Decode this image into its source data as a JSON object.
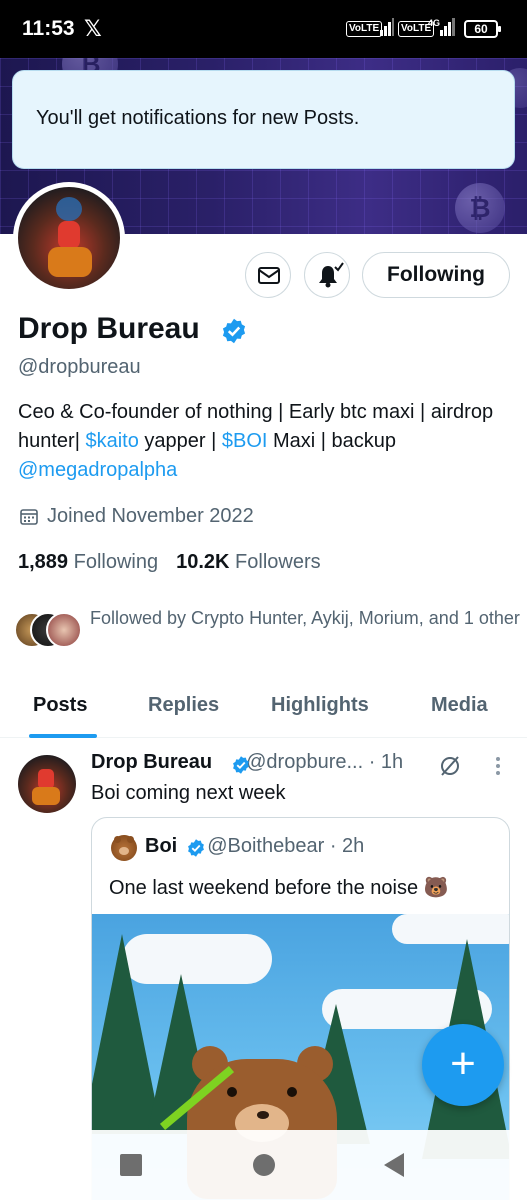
{
  "status_bar": {
    "time": "11:53",
    "app_icon": "x-logo",
    "volte1": "VoLTE",
    "volte2": "VoLTE",
    "network": "4G",
    "battery": "60"
  },
  "toast": {
    "message": "You'll get notifications for new Posts."
  },
  "profile": {
    "name": "Drop Bureau",
    "handle": "@dropbureau",
    "verified": true,
    "bio_parts": {
      "p1": "Ceo & Co-founder of nothing | Early btc maxi | airdrop hunter| ",
      "link1": "$kaito",
      "p2": " yapper | ",
      "link2": "$BOI",
      "p3": " Maxi | backup ",
      "link3": "@megadropalpha"
    },
    "joined": "Joined November 2022",
    "following_count": "1,889",
    "following_label": "Following",
    "followers_count": "10.2K",
    "followers_label": "Followers",
    "followed_by": "Followed by Crypto Hunter, Aykij, Morium, and 1 other",
    "follow_button": "Following"
  },
  "tabs": [
    {
      "label": "Posts",
      "active": true
    },
    {
      "label": "Replies",
      "active": false
    },
    {
      "label": "Highlights",
      "active": false
    },
    {
      "label": "Media",
      "active": false
    }
  ],
  "post": {
    "author": "Drop Bureau",
    "handle_time": "@dropbure... · 1h",
    "text": "Boi coming next week",
    "quote": {
      "author": "Boi",
      "handle_time": "@Boithebear · 2h",
      "text": "One last weekend before the noise 🐻"
    }
  },
  "fab_label": "+",
  "colors": {
    "accent": "#1d9bf0",
    "text_primary": "#0f1419",
    "text_secondary": "#536471",
    "toast_bg": "#e6f5fd"
  }
}
